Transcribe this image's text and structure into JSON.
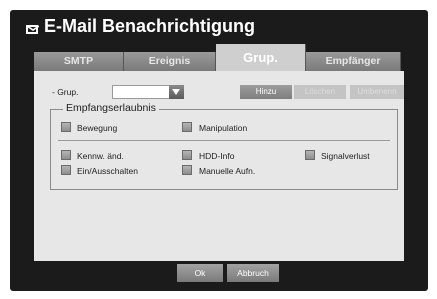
{
  "window": {
    "title": "E-Mail Benachrichtigung"
  },
  "tabs": [
    {
      "label": "SMTP",
      "active": false
    },
    {
      "label": "Ereignis",
      "active": false
    },
    {
      "label": "Grup.",
      "active": true
    },
    {
      "label": "Empfänger",
      "active": false
    }
  ],
  "group_row": {
    "label": "- Grup.",
    "select_value": "",
    "add_label": "Hinzu",
    "delete_label": "Löschen",
    "rename_label": "Umbenenn"
  },
  "permissions": {
    "title": "Empfangserlaubnis",
    "items": [
      {
        "label": "Bewegung"
      },
      {
        "label": "Manipulation"
      },
      {
        "label": "Kennw. änd."
      },
      {
        "label": "HDD-Info"
      },
      {
        "label": "Signalverlust"
      },
      {
        "label": "Ein/Ausschalten"
      },
      {
        "label": "Manuelle Aufn."
      }
    ]
  },
  "footer": {
    "ok_label": "Ok",
    "cancel_label": "Abbruch"
  },
  "colors": {
    "frame": "#1b1b1b",
    "panel": "#e7e7e7",
    "tab_active": "#cfcfcf",
    "tab": "#8a8a8a"
  }
}
